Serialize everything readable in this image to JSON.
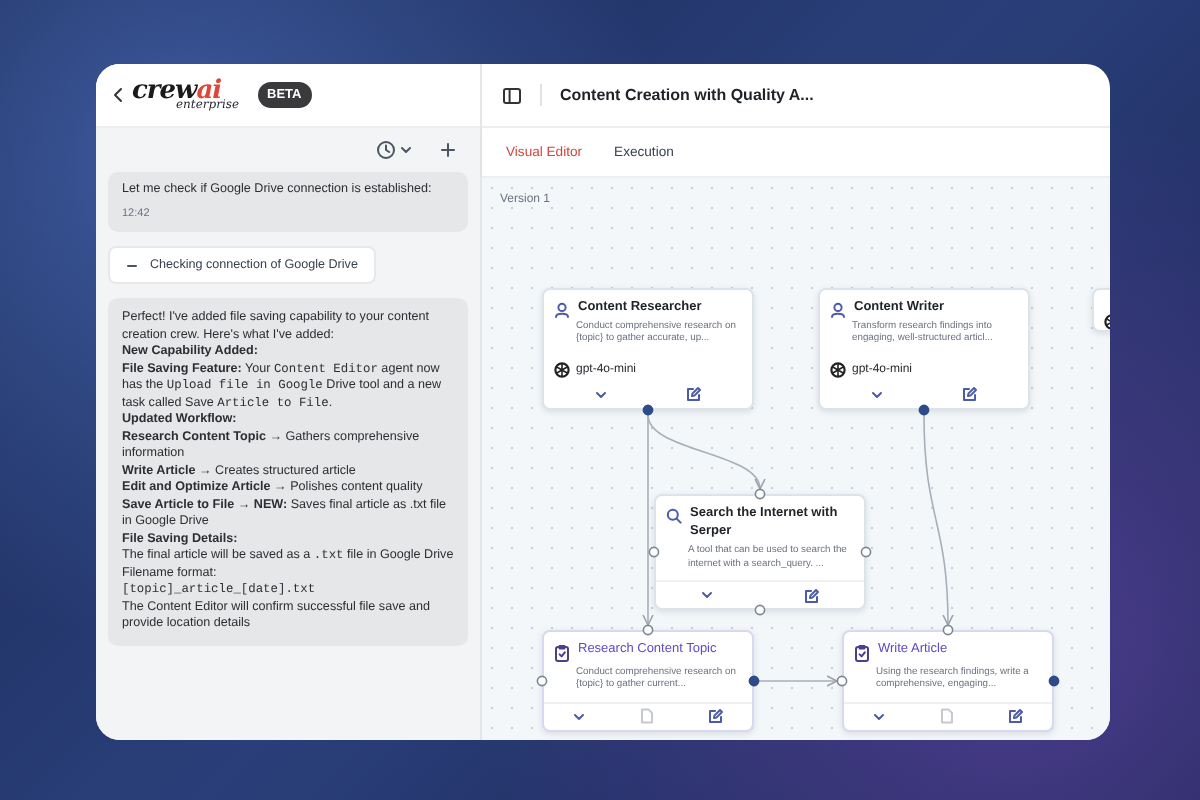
{
  "sidebar": {
    "logo": {
      "word": "crew",
      "accent": "ai",
      "sub": "enterprise"
    },
    "badge": "BETA",
    "chat": [
      {
        "kind": "message",
        "text": "Let me check if Google Drive connection is established:",
        "time": "12:42"
      },
      {
        "kind": "status",
        "text": "Checking connection of Google Drive"
      },
      {
        "kind": "rich",
        "paragraphs": [
          [
            {
              "kind": "text",
              "text": "Perfect! I've added file saving capability to your content creation crew. Here's what I've added:"
            }
          ],
          [
            {
              "kind": "bold",
              "text": "New Capability Added:"
            }
          ],
          [
            {
              "kind": "bold",
              "text": "File Saving Feature:"
            },
            {
              "kind": "text",
              "text": " Your "
            },
            {
              "kind": "code",
              "text": "Content Editor"
            },
            {
              "kind": "text",
              "text": " agent now has the "
            },
            {
              "kind": "code",
              "text": "Upload file in Google"
            },
            {
              "kind": "text",
              "text": " Drive tool and a new task called Save "
            },
            {
              "kind": "code",
              "text": "Article to File"
            },
            {
              "kind": "text",
              "text": "."
            }
          ],
          [
            {
              "kind": "bold",
              "text": "Updated Workflow:"
            }
          ],
          [
            {
              "kind": "bold",
              "text": "Research Content Topic"
            },
            {
              "kind": "text",
              "text": " → Gathers comprehensive information"
            }
          ],
          [
            {
              "kind": "bold",
              "text": "Write Article"
            },
            {
              "kind": "text",
              "text": " → Creates structured article"
            }
          ],
          [
            {
              "kind": "bold",
              "text": "Edit and Optimize Article"
            },
            {
              "kind": "text",
              "text": " → Polishes content quality"
            }
          ],
          [
            {
              "kind": "bold",
              "text": "Save Article to File → NEW:"
            },
            {
              "kind": "text",
              "text": " Saves final article as .txt file in Google Drive"
            }
          ],
          [
            {
              "kind": "bold",
              "text": "File Saving Details:"
            }
          ],
          [
            {
              "kind": "text",
              "text": "The final article will be saved as a "
            },
            {
              "kind": "code",
              "text": ".txt"
            },
            {
              "kind": "text",
              "text": " file in Google Drive"
            }
          ],
          [
            {
              "kind": "text",
              "text": "Filename format:"
            }
          ],
          [
            {
              "kind": "code",
              "text": "[topic]_article_[date].txt"
            }
          ],
          [
            {
              "kind": "text",
              "text": "The Content Editor will confirm successful file save and provide location details"
            }
          ]
        ]
      }
    ]
  },
  "main": {
    "title": "Content Creation with Quality A...",
    "tabs": [
      {
        "label": "Visual Editor",
        "selected": true
      },
      {
        "label": "Execution",
        "selected": false
      }
    ],
    "canvas": {
      "version": "Version 1",
      "nodes": [
        {
          "kind": "agent",
          "title": "Content Researcher",
          "description": "Conduct comprehensive research on {topic} to gather accurate, up...",
          "model": "gpt-4o-mini"
        },
        {
          "kind": "agent",
          "title": "Content Writer",
          "description": "Transform research findings into engaging, well-structured articl...",
          "model": "gpt-4o-mini"
        },
        {
          "kind": "tool",
          "title": "Search the Internet with Serper",
          "description": "A tool that can be used to search the internet with a search_query. ..."
        },
        {
          "kind": "task",
          "title": "Research Content Topic",
          "description": "Conduct comprehensive research on {topic} to gather current..."
        },
        {
          "kind": "task",
          "title": "Write Article",
          "description": "Using the research findings, write a comprehensive, engaging..."
        },
        {
          "kind": "agent"
        }
      ]
    }
  }
}
